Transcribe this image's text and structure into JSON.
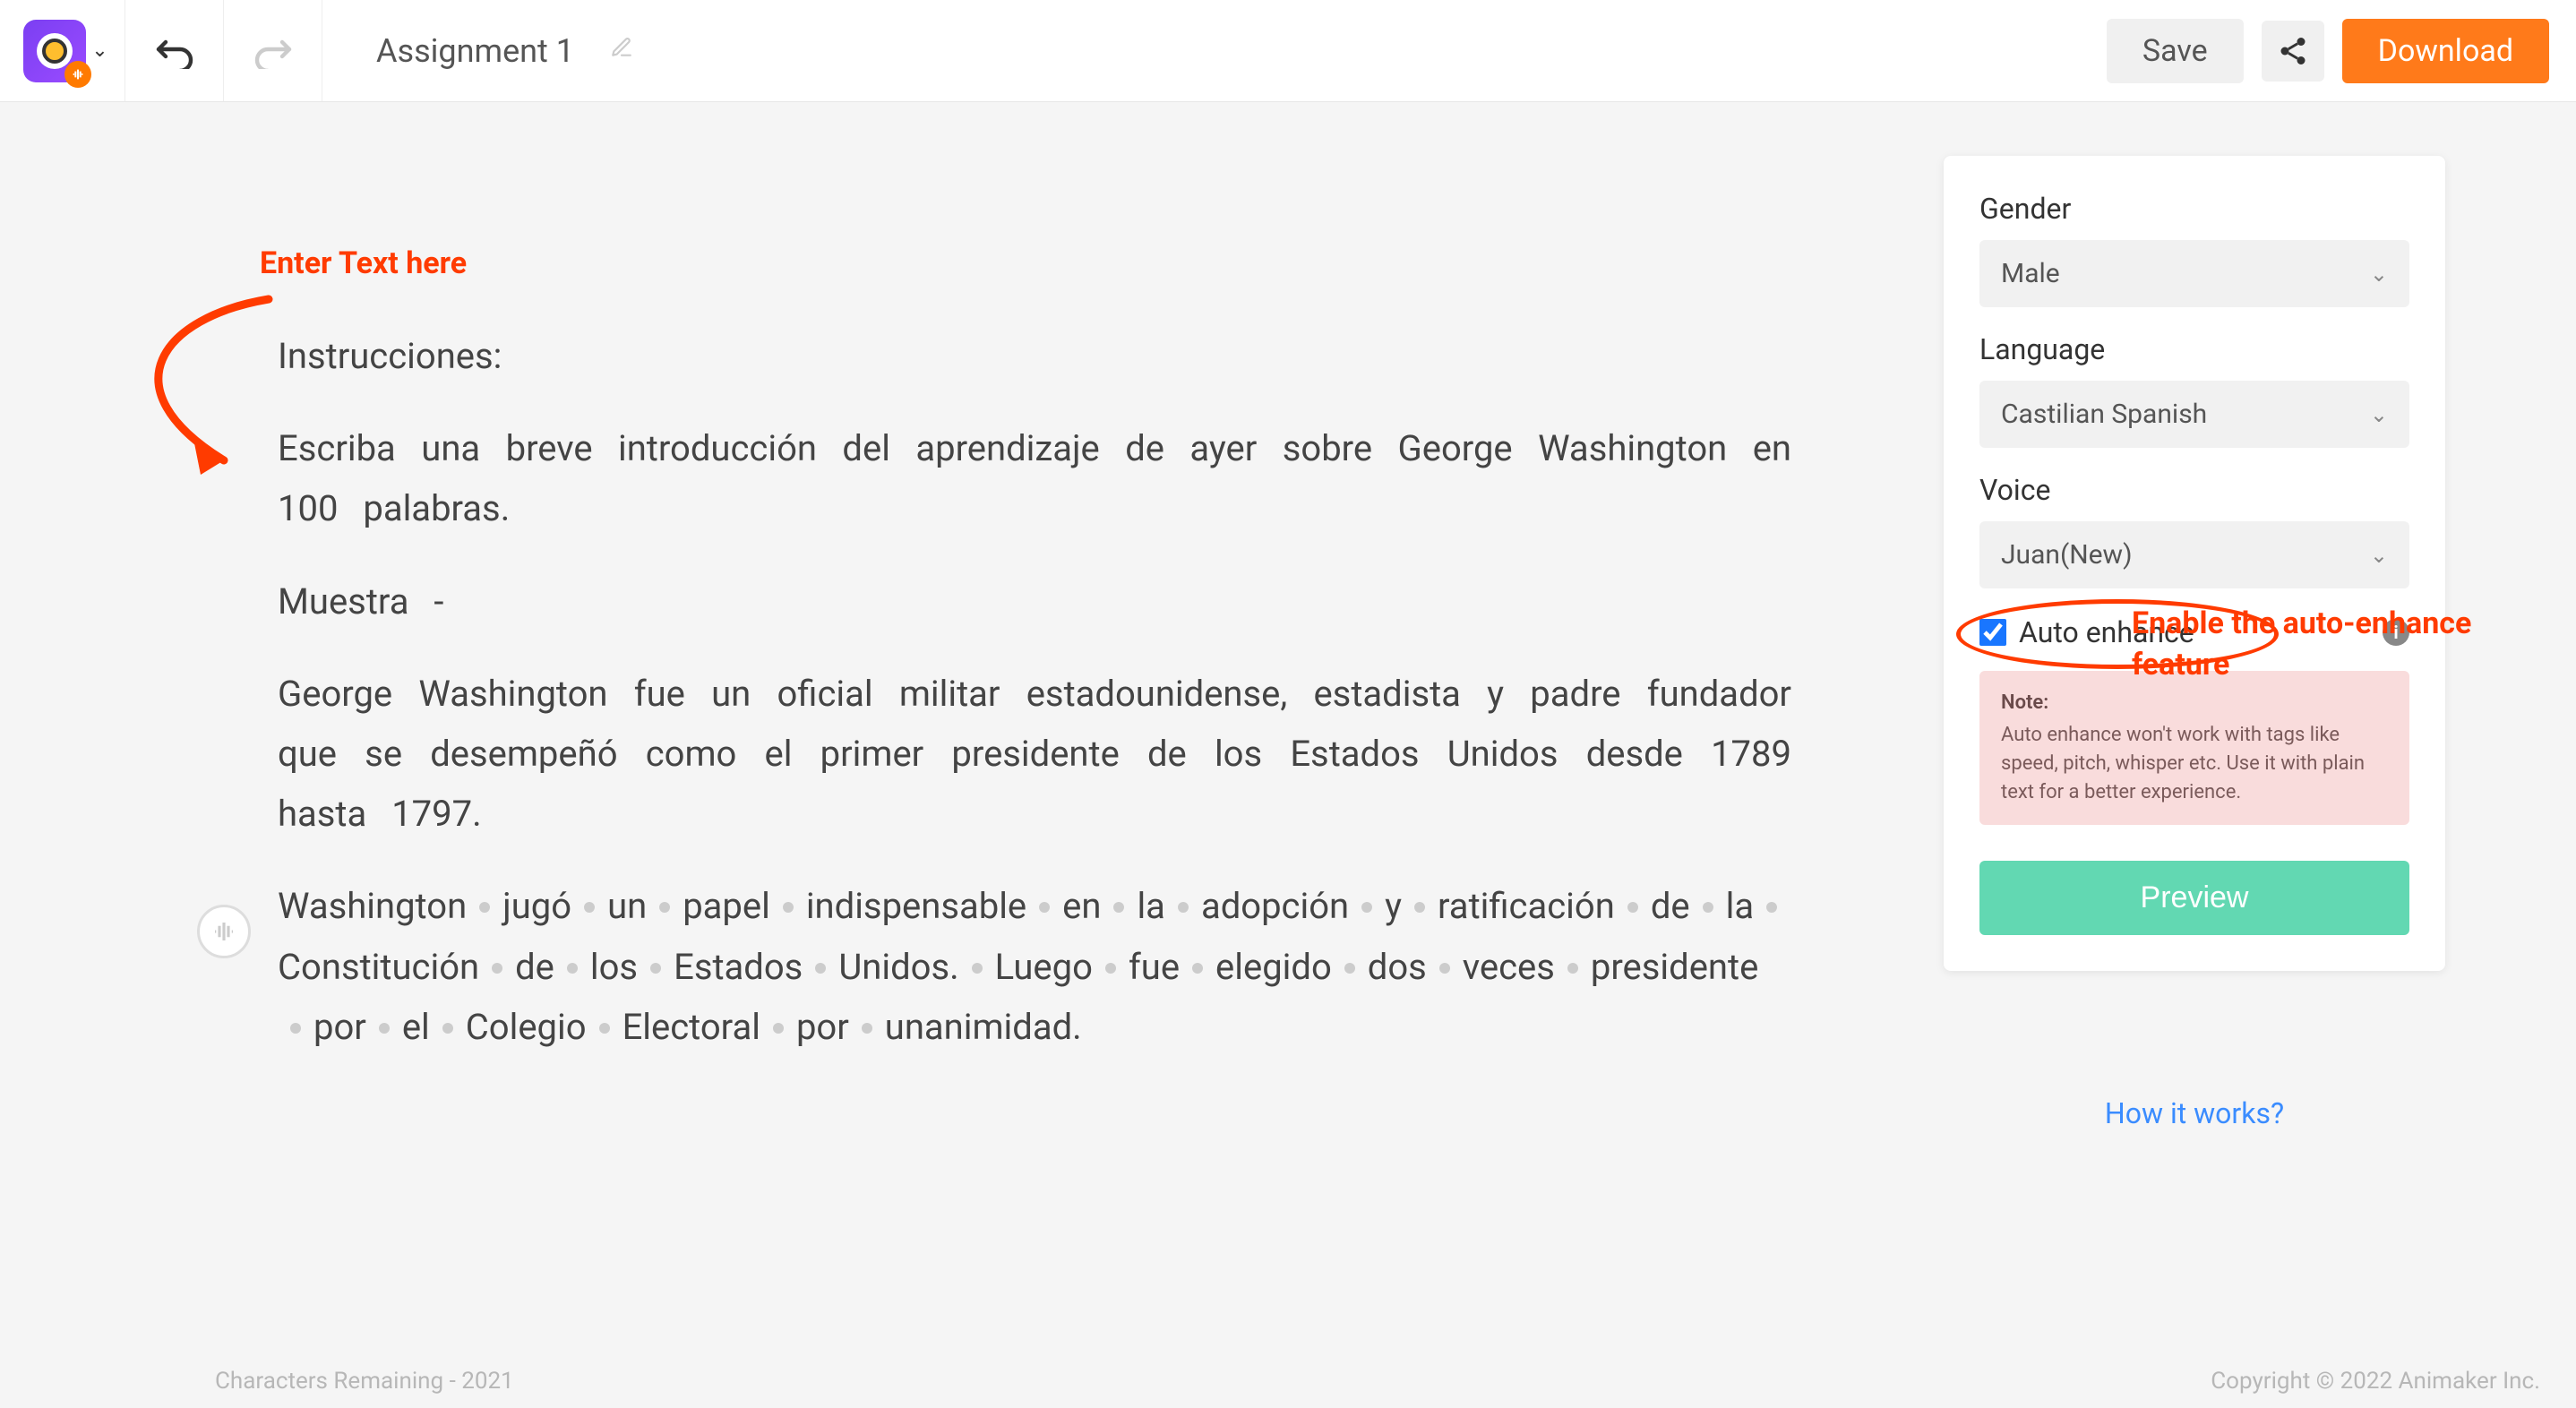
{
  "header": {
    "project_name": "Assignment 1",
    "save_label": "Save",
    "download_label": "Download"
  },
  "annotations": {
    "enter_text": "Enter Text here",
    "enable_feature": "Enable the auto-enhance feature"
  },
  "editor": {
    "heading": "Instrucciones:",
    "p1": "Escriba una breve introducción del aprendizaje de ayer sobre George Washington en 100 palabras.",
    "p2": "Muestra  -",
    "p3": "George Washington fue un oficial militar estadounidense, estadista y padre fundador que se desempeñó como el primer presidente de los Estados Unidos desde 1789 hasta 1797.",
    "p4_words": [
      "Washington",
      "jugó",
      "un",
      "papel",
      "indispensable",
      "en",
      "la",
      "adopción",
      "y",
      "ratificación",
      "de",
      "la",
      "Constitución",
      "de",
      "los",
      "Estados",
      "Unidos.",
      "Luego",
      "fue",
      "elegido",
      "dos",
      "veces",
      "presidente",
      "por",
      "el",
      "Colegio",
      "Electoral",
      "por",
      "unanimidad."
    ]
  },
  "panel": {
    "gender_label": "Gender",
    "gender_value": "Male",
    "language_label": "Language",
    "language_value": "Castilian Spanish",
    "voice_label": "Voice",
    "voice_value": "Juan(New)",
    "auto_enhance_label": "Auto enhance",
    "auto_enhance_checked": true,
    "note_title": "Note:",
    "note_body": "Auto enhance won't work with tags like speed, pitch, whisper etc. Use it with plain text for a better experience.",
    "preview_label": "Preview",
    "how_it_works": "How it works?"
  },
  "footer": {
    "chars_remaining_label": "Characters Remaining - ",
    "chars_remaining_value": "2021",
    "copyright": "Copyright © 2022 Animaker Inc."
  }
}
